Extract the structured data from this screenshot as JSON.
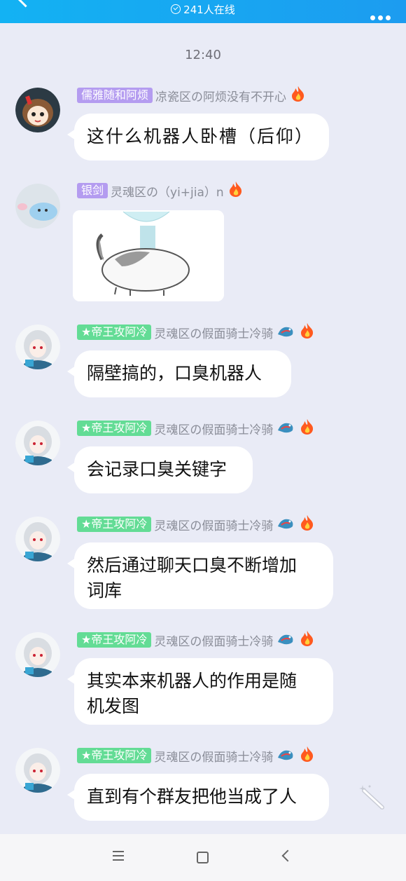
{
  "header": {
    "online_text": "241人在线"
  },
  "chat": {
    "timestamp": "12:40",
    "messages": [
      {
        "tag": "儒雅随和阿烦",
        "nick": "凉瓷区の阿烦没有不开心",
        "text": "这什么机器人卧槽（后仰）"
      },
      {
        "tag": "银剑",
        "nick": "灵魂区の（yi+jia）n",
        "image": "cat-sticker"
      },
      {
        "tag": "★帝王攻阿冷",
        "nick": "灵魂区の假面骑士冷骑",
        "text": "隔壁搞的，口臭机器人"
      },
      {
        "tag": "★帝王攻阿冷",
        "nick": "灵魂区の假面骑士冷骑",
        "text": "会记录口臭关键字"
      },
      {
        "tag": "★帝王攻阿冷",
        "nick": "灵魂区の假面骑士冷骑",
        "line1": "然后通过聊天口臭不断增加",
        "line2": "词库"
      },
      {
        "tag": "★帝王攻阿冷",
        "nick": "灵魂区の假面骑士冷骑",
        "line1": "其实本来机器人的作用是随",
        "line2": "机发图"
      },
      {
        "tag": "★帝王攻阿冷",
        "nick": "灵魂区の假面骑士冷骑",
        "text": "直到有个群友把他当成了人"
      }
    ]
  },
  "colors": {
    "topbar": "#13b2f3",
    "background": "#e9ebf6",
    "tag_purple": "#b49cf0",
    "tag_green": "#63dc95"
  },
  "icons": {
    "back": "chevron-left-icon",
    "more": "more-dots-icon",
    "fire": "fire-icon",
    "dragon": "dragon-badge-icon",
    "wand": "magic-wand-icon"
  }
}
